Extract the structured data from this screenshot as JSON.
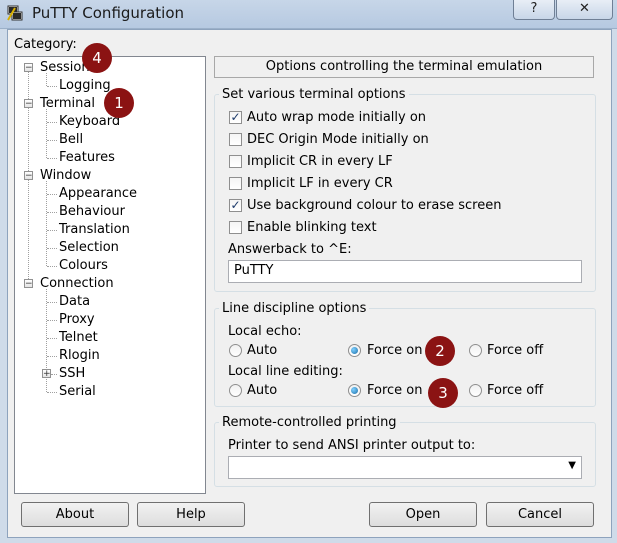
{
  "window": {
    "title": "PuTTY Configuration",
    "help_glyph": "?",
    "close_glyph": "✕"
  },
  "category_label": "Category:",
  "tree": {
    "items": [
      {
        "label": "Session",
        "glyph": "−"
      },
      {
        "label": "Logging"
      },
      {
        "label": "Terminal",
        "glyph": "−"
      },
      {
        "label": "Keyboard"
      },
      {
        "label": "Bell"
      },
      {
        "label": "Features"
      },
      {
        "label": "Window",
        "glyph": "−"
      },
      {
        "label": "Appearance"
      },
      {
        "label": "Behaviour"
      },
      {
        "label": "Translation"
      },
      {
        "label": "Selection"
      },
      {
        "label": "Colours"
      },
      {
        "label": "Connection",
        "glyph": "−"
      },
      {
        "label": "Data"
      },
      {
        "label": "Proxy"
      },
      {
        "label": "Telnet"
      },
      {
        "label": "Rlogin"
      },
      {
        "label": "SSH",
        "glyph": "+"
      },
      {
        "label": "Serial"
      }
    ]
  },
  "panel": {
    "header": "Options controlling the terminal emulation",
    "terminal_options": {
      "title": "Set various terminal options",
      "checkboxes": [
        {
          "label": "Auto wrap mode initially on",
          "checked": true,
          "mark": "✓"
        },
        {
          "label": "DEC Origin Mode initially on",
          "checked": false,
          "mark": ""
        },
        {
          "label": "Implicit CR in every LF",
          "checked": false,
          "mark": ""
        },
        {
          "label": "Implicit LF in every CR",
          "checked": false,
          "mark": ""
        },
        {
          "label": "Use background colour to erase screen",
          "checked": true,
          "mark": "✓"
        },
        {
          "label": "Enable blinking text",
          "checked": false,
          "mark": ""
        }
      ],
      "answerback_label": "Answerback to ^E:",
      "answerback_value": "PuTTY"
    },
    "line_discipline": {
      "title": "Line discipline options",
      "local_echo": {
        "label": "Local echo:",
        "options": [
          "Auto",
          "Force on",
          "Force off"
        ],
        "selected": "Force on"
      },
      "local_line_editing": {
        "label": "Local line editing:",
        "options": [
          "Auto",
          "Force on",
          "Force off"
        ],
        "selected": "Force on"
      }
    },
    "printing": {
      "title": "Remote-controlled printing",
      "printer_label": "Printer to send ANSI printer output to:",
      "printer_value": "",
      "dropdown_glyph": "▼"
    }
  },
  "buttons": {
    "about": "About",
    "help": "Help",
    "open": "Open",
    "cancel": "Cancel"
  },
  "badges": [
    "4",
    "1",
    "2",
    "3"
  ],
  "colors": {
    "badge": "#8b1313",
    "title_bar": "#b6c9e1",
    "radio_selected": "#1a6ea8"
  }
}
